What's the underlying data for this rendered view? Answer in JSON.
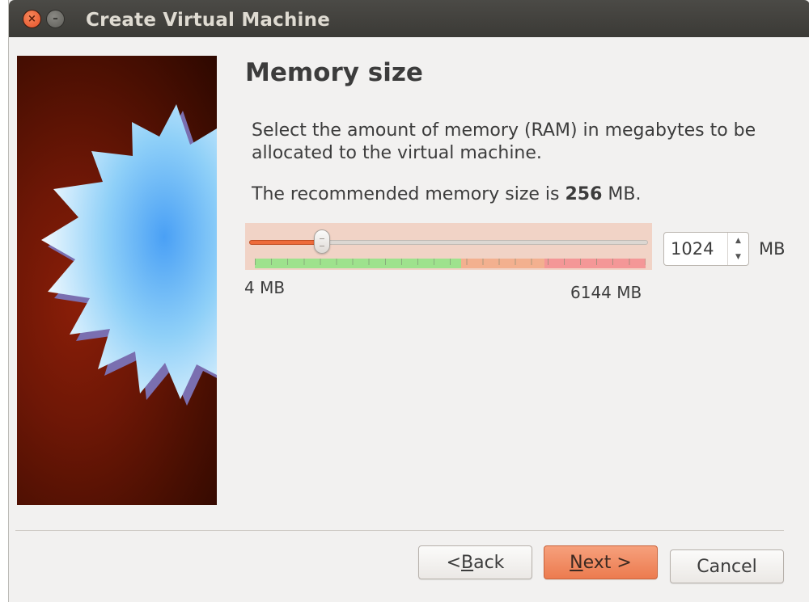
{
  "window": {
    "title": "Create Virtual Machine",
    "close_glyph": "×",
    "minimize_glyph": "–"
  },
  "page": {
    "heading": "Memory size",
    "description": "Select the amount of memory (RAM) in megabytes to be allocated to the virtual machine.",
    "recommended_prefix": "The recommended memory size is ",
    "recommended_value": "256",
    "recommended_suffix": " MB."
  },
  "memory": {
    "slider_min_label": "4 MB",
    "slider_max_label": "6144 MB",
    "slider_min": 4,
    "slider_max": 6144,
    "current_value": "1024",
    "unit": "MB",
    "spin_up_glyph": "▲",
    "spin_down_glyph": "▼"
  },
  "buttons": {
    "back_mnemonic": "B",
    "back_rest": "ack",
    "back_prefix": "< ",
    "next_mnemonic": "N",
    "next_rest": "ext >",
    "cancel": "Cancel"
  },
  "colors": {
    "accent": "#ee6b3b",
    "zone_green": "#9ee28d",
    "zone_orange": "#f3b08f",
    "zone_red": "#f49797"
  },
  "icons": {
    "side_image": "virtualbox-starburst-icon",
    "close": "close-icon",
    "minimize": "minimize-icon"
  }
}
